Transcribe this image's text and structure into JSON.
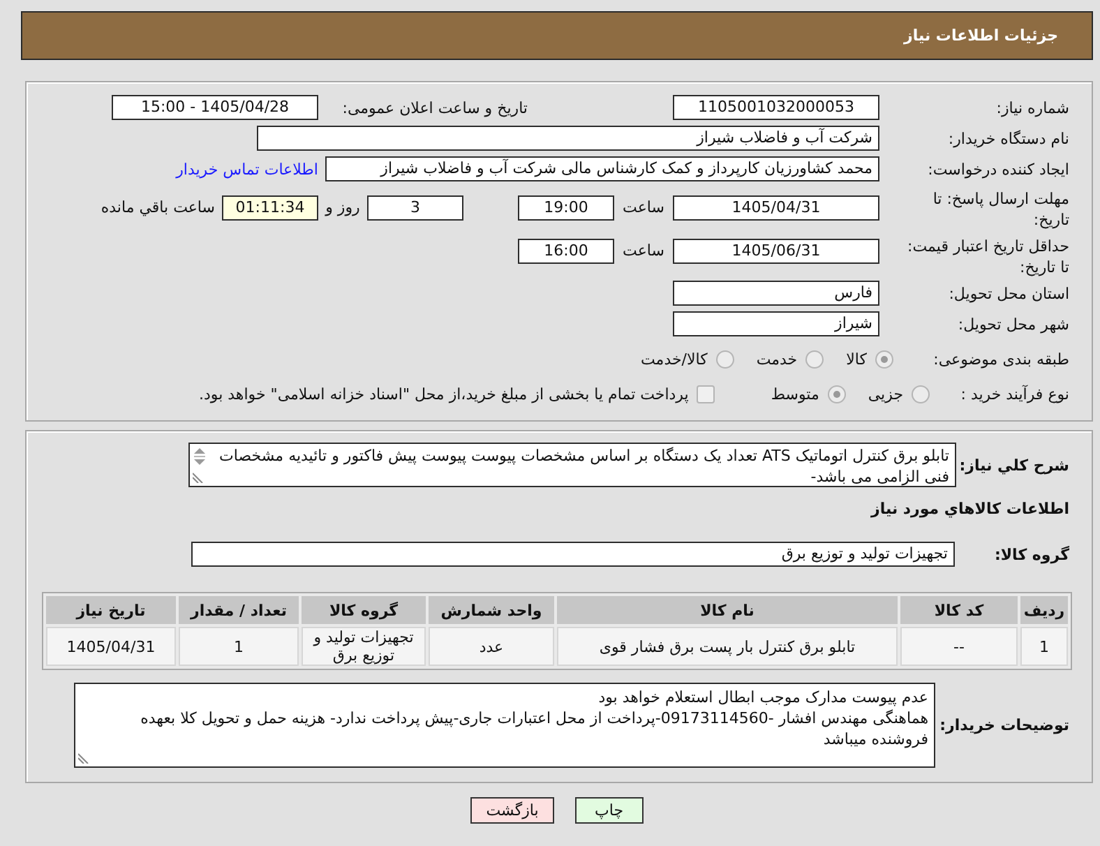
{
  "header": {
    "title": "جزئیات اطلاعات نیاز"
  },
  "details": {
    "need_number": {
      "label": "شماره نیاز:",
      "value": "1105001032000053"
    },
    "announcement": {
      "label": "تاریخ و ساعت اعلان عمومی:",
      "value": "1405/04/28 - 15:00"
    },
    "buyer_org": {
      "label": "نام دستگاه خریدار:",
      "value": "شرکت آب و فاضلاب شیراز"
    },
    "requester": {
      "label": "ایجاد کننده درخواست:",
      "value": "محمد کشاورزیان کارپرداز و کمک کارشناس مالی شرکت آب و فاضلاب شیراز",
      "link": "اطلاعات تماس خریدار"
    },
    "reply_deadline": {
      "label": "مهلت ارسال پاسخ: تا تاریخ:",
      "date": "1405/04/31",
      "time_label": "ساعت",
      "time": "19:00",
      "days": "3",
      "days_label": "روز و",
      "remaining": "01:11:34",
      "remaining_label": "ساعت باقي مانده"
    },
    "price_validity": {
      "label": "حداقل تاریخ اعتبار قیمت: تا تاریخ:",
      "date": "1405/06/31",
      "time_label": "ساعت",
      "time": "16:00"
    },
    "province": {
      "label": "استان محل تحویل:",
      "value": "فارس"
    },
    "city": {
      "label": "شهر محل تحویل:",
      "value": "شیراز"
    },
    "category": {
      "label": "طبقه بندی موضوعی:",
      "options": [
        {
          "label": "کالا",
          "selected": true
        },
        {
          "label": "خدمت",
          "selected": false
        },
        {
          "label": "کالا/خدمت",
          "selected": false
        }
      ]
    },
    "purchase_type": {
      "label": "نوع فرآیند خرید :",
      "options": [
        {
          "label": "جزیی",
          "selected": false
        },
        {
          "label": "متوسط",
          "selected": true
        }
      ],
      "treasury": {
        "label": "پرداخت تمام یا بخشی از مبلغ خرید،از محل \"اسناد خزانه اسلامی\" خواهد بود.",
        "checked": false
      }
    }
  },
  "need": {
    "description": {
      "label": "شرح کلي نیاز:",
      "value": "تابلو برق کنترل اتوماتیک ATS تعداد یک دستگاه بر اساس مشخصات پیوست پیوست پیش فاکتور و تائیدیه مشخصات فنی الزامی می باشد-"
    },
    "goods_title": "اطلاعات کالاهاي مورد نیاز",
    "goods_group": {
      "label": "گروه کالا:",
      "value": "تجهیزات تولید و توزیع برق"
    },
    "table": {
      "columns": [
        "ردیف",
        "کد کالا",
        "نام کالا",
        "واحد شمارش",
        "گروه کالا",
        "تعداد / مقدار",
        "تاریخ نیاز"
      ],
      "rows": [
        [
          "1",
          "--",
          "تابلو برق کنترل بار پست برق فشار قوی",
          "عدد",
          "تجهیزات تولید و توزیع برق",
          "1",
          "1405/04/31"
        ]
      ]
    },
    "buyer_notes": {
      "label": "توضیحات خریدار:",
      "value": "عدم پیوست مدارک موجب ابطال استعلام خواهد بود\nهماهنگی مهندس افشار -09173114560-پرداخت از محل اعتبارات جاری-پیش پرداخت ندارد- هزینه حمل و تحویل کلا بعهده فروشنده میباشد"
    }
  },
  "buttons": [
    {
      "label": "چاپ",
      "kind": "print"
    },
    {
      "label": "بازگشت",
      "kind": "back"
    }
  ]
}
